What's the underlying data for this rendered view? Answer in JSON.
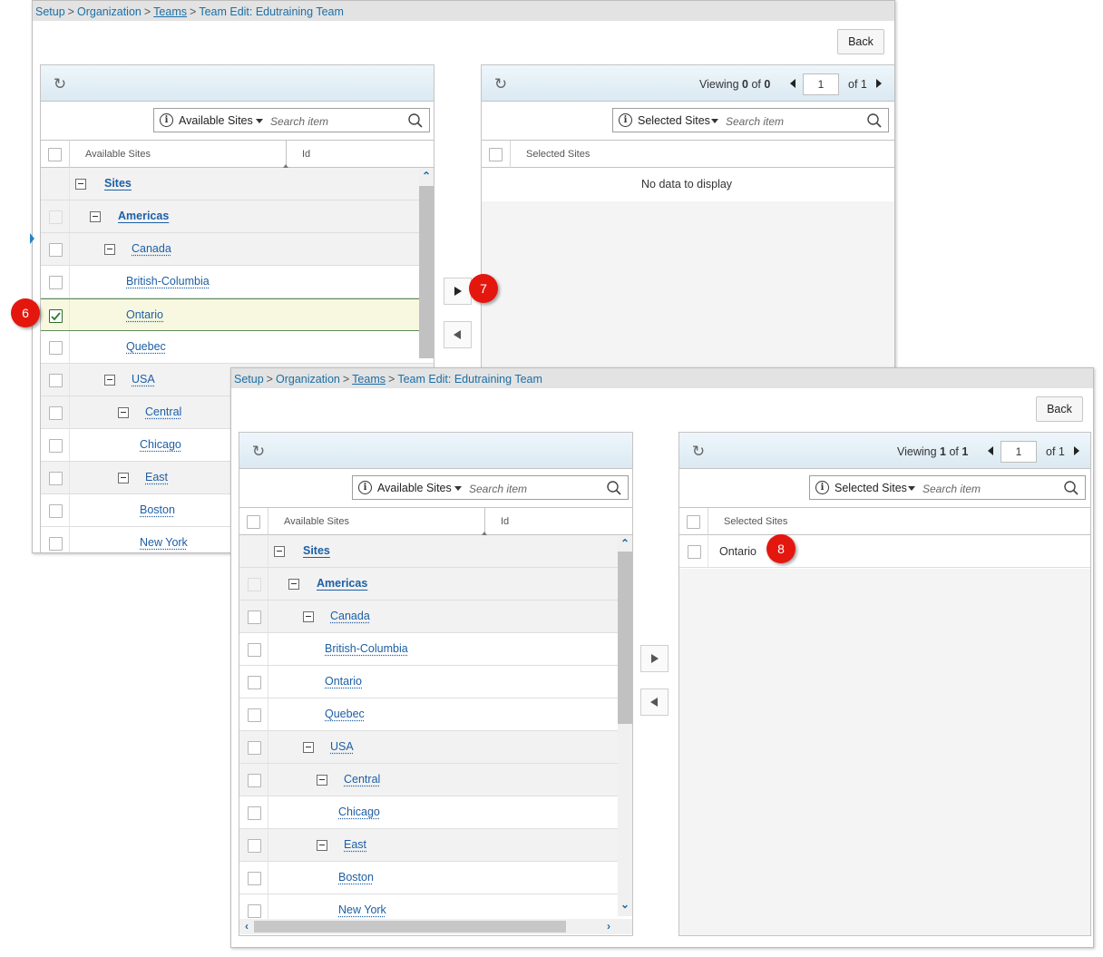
{
  "breadcrumb": {
    "setup": "Setup",
    "organization": "Organization",
    "teams": "Teams",
    "current": "Team Edit: Edutraining Team"
  },
  "back_label": "Back",
  "available": {
    "dropdown_label": "Available Sites",
    "search_placeholder": "Search item",
    "col_available": "Available Sites",
    "col_id": "Id"
  },
  "selected": {
    "dropdown_label": "Selected Sites",
    "search_placeholder": "Search item",
    "col_selected": "Selected Sites"
  },
  "tree": {
    "sites": "Sites",
    "americas": "Americas",
    "canada": "Canada",
    "british_columbia": "British-Columbia",
    "ontario": "Ontario",
    "quebec": "Quebec",
    "usa": "USA",
    "central": "Central",
    "chicago": "Chicago",
    "east": "East",
    "boston": "Boston",
    "new_york": "New York"
  },
  "before": {
    "viewing_text": "Viewing",
    "viewing_current": "0",
    "viewing_of": "of",
    "viewing_total": "0",
    "page": "1",
    "of_pages": "of 1",
    "no_data": "No data to display"
  },
  "after": {
    "viewing_text": "Viewing",
    "viewing_current": "1",
    "viewing_of": "of",
    "viewing_total": "1",
    "page": "1",
    "of_pages": "of 1",
    "selected_rows": [
      "Ontario"
    ]
  },
  "steps": {
    "s6": "6",
    "s7": "7",
    "s8": "8"
  },
  "colors": {
    "link": "#1d5fa5",
    "step_badge": "#e3170e",
    "header_gradient": "#dbe9f2"
  }
}
